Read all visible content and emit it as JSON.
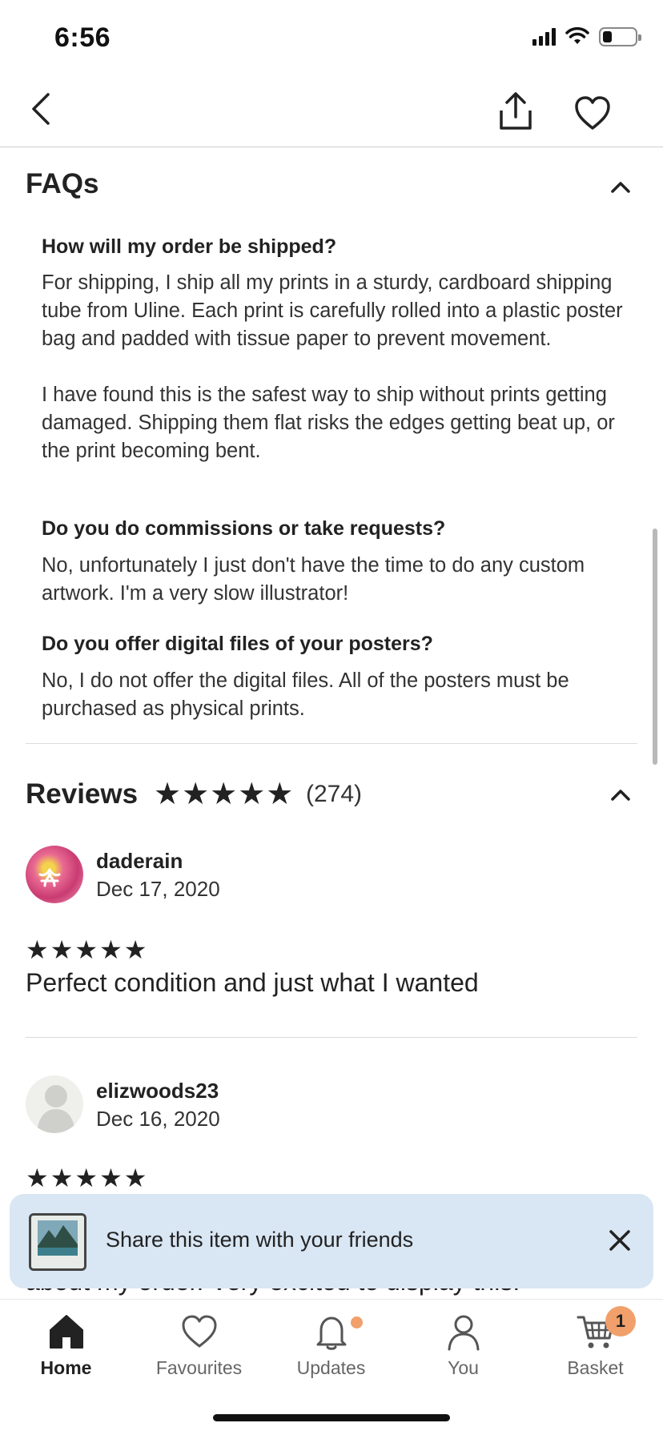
{
  "status_bar": {
    "time": "6:56"
  },
  "faqs": {
    "title": "FAQs",
    "items": [
      {
        "question": "How will my order be shipped?",
        "answer": "For shipping, I ship all my prints in a sturdy, cardboard shipping tube from Uline.  Each print is carefully rolled into a plastic poster bag and padded with tissue paper to prevent movement.\n\nI have found this is the safest way to ship without prints getting damaged.  Shipping them flat risks the edges getting beat up, or the print becoming bent."
      },
      {
        "question": "Do you do commissions or take requests?",
        "answer": "No, unfortunately I just don't have the time to do any custom artwork.  I'm a very slow illustrator!"
      },
      {
        "question": "Do you offer digital files of your posters?",
        "answer": "No, I do not offer the digital files.  All of the posters must be purchased as physical prints."
      }
    ]
  },
  "reviews": {
    "title": "Reviews",
    "stars": "★★★★★",
    "count": "(274)",
    "items": [
      {
        "name": "daderain",
        "date": "Dec 17, 2020",
        "stars": "★★★★★",
        "text": "Perfect condition and just what I wanted"
      },
      {
        "name": "elizwoods23",
        "date": "Dec 16, 2020",
        "stars": "★★★★★",
        "text": "about my order. Very excited to display this."
      }
    ]
  },
  "share_banner": {
    "text": "Share this item with your friends"
  },
  "tab_bar": {
    "items": [
      {
        "label": "Home",
        "icon": "home-icon"
      },
      {
        "label": "Favourites",
        "icon": "heart-icon"
      },
      {
        "label": "Updates",
        "icon": "bell-icon"
      },
      {
        "label": "You",
        "icon": "person-icon"
      },
      {
        "label": "Basket",
        "icon": "cart-icon"
      }
    ],
    "basket_count": "1"
  },
  "colors": {
    "accent_badge": "#f1a06b",
    "banner_bg": "#d9e6f3",
    "text": "#222222"
  }
}
